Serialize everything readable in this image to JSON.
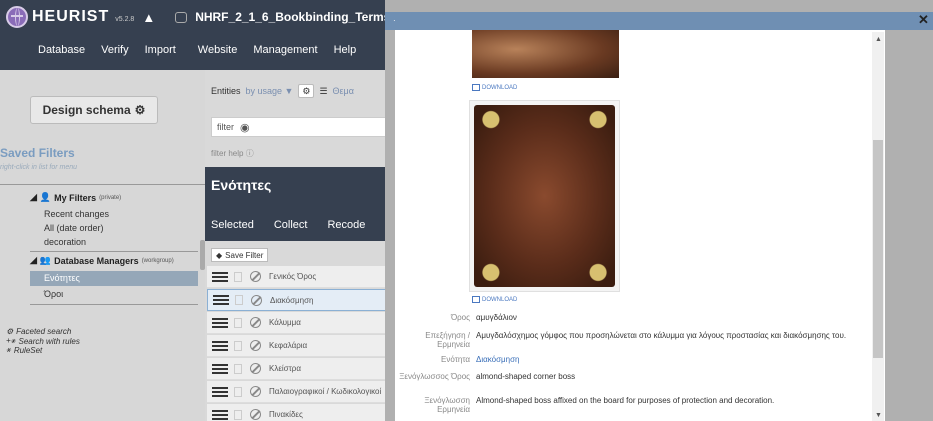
{
  "app": {
    "brand": "HEURIST",
    "version": "v5.2.8",
    "db_name": "NHRF_2_1_6_Bookbinding_Terms",
    "menu": [
      "Database",
      "Verify",
      "Import",
      "Website",
      "Management",
      "Help"
    ]
  },
  "left": {
    "design_button": "Design schema",
    "saved_filters_title": "Saved Filters",
    "saved_filters_hint": "right-click in list for menu",
    "my_filters": {
      "label": "My Filters",
      "tag": "(private)",
      "items": [
        "Recent changes",
        "All (date order)",
        "decoration"
      ]
    },
    "managers": {
      "label": "Database Managers",
      "tag": "(workgroup)",
      "items": [
        "Ενότητες",
        "Όροι"
      ]
    },
    "tools": [
      "Faceted search",
      "Search with rules",
      "RuleSet"
    ]
  },
  "middle": {
    "entities_label": "Entities",
    "sort_label": "by usage ▼",
    "view_label": "Θεμα",
    "filter_label": "filter",
    "filter_help": "filter help",
    "header_title": "Ενότητες",
    "actions": [
      "Selected",
      "Collect",
      "Recode"
    ],
    "save_filter": "Save Filter",
    "rows": [
      "Γενικός Όρος",
      "Διακόσμηση",
      "Κάλυμμα",
      "Κεφαλάρια",
      "Κλείστρα",
      "Παλαιογραφικοί / Κωδικολογικοί",
      "Πινακίδες"
    ]
  },
  "viewer": {
    "download_label": "DOWNLOAD",
    "fields": [
      {
        "label": "Όρος",
        "value": "αμυγδάλιον"
      },
      {
        "label": "Επεξήγηση / Ερμηνεία",
        "value": "Αμυγδαλόσχημος γόμφος που προσηλώνεται στο κάλυμμα για λόγους προστασίας και διακόσμησης του."
      },
      {
        "label": "Ενότητα",
        "value": "Διακόσμηση"
      },
      {
        "label": "Ξενόγλωσσος Όρος",
        "value": "almond-shaped corner boss"
      },
      {
        "label": "Ξενόγλωσση Ερμηνεία",
        "value": "Almond-shaped boss affixed on the board for purposes of protection and decoration."
      }
    ]
  },
  "colors": {
    "header": "#364050",
    "accent": "#6f8fb3",
    "link": "#3a6fb8"
  }
}
